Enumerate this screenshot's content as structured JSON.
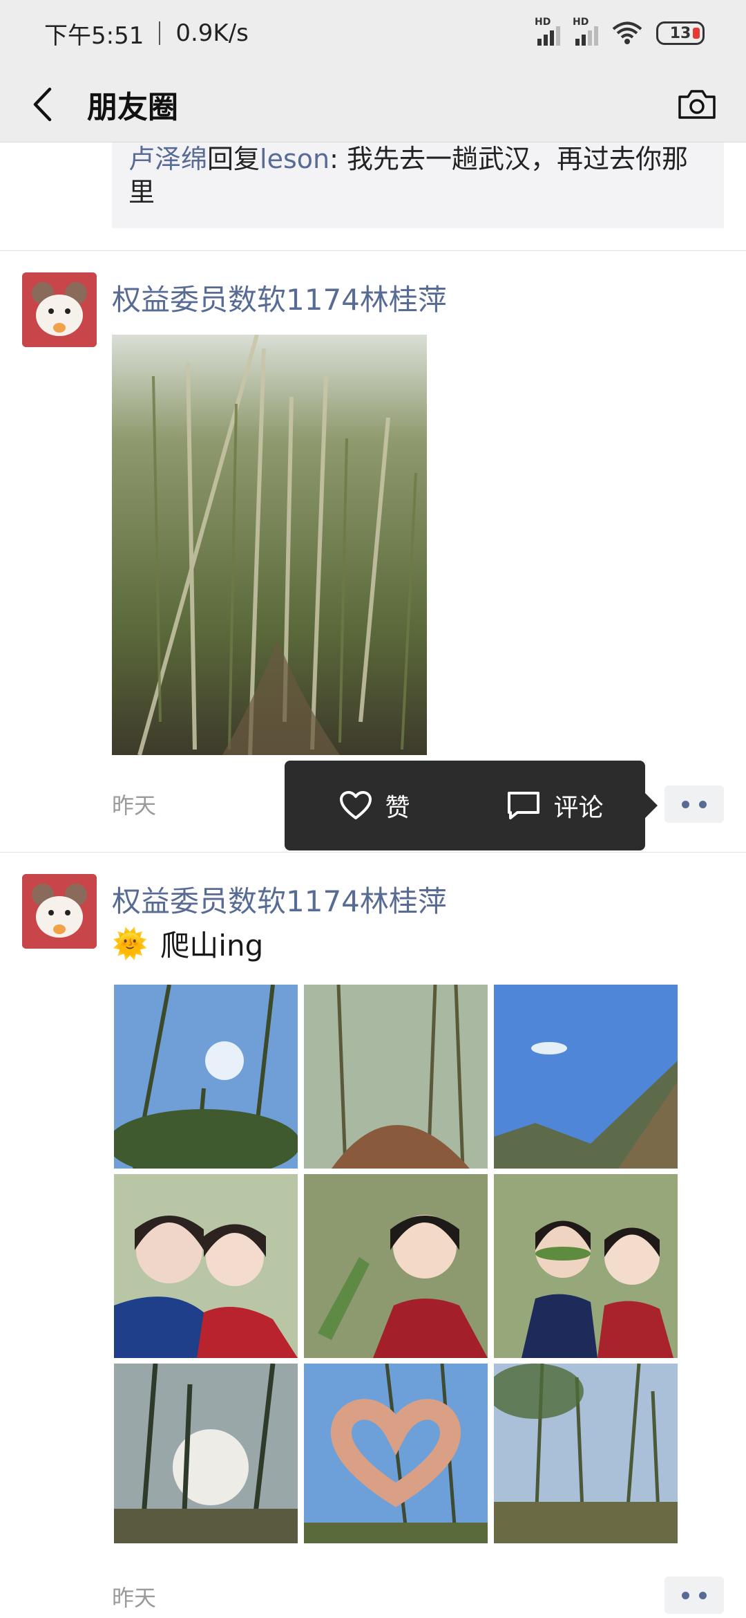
{
  "status_bar": {
    "time": "下午5:51",
    "speed": "0.9K/s",
    "signal1_label": "HD",
    "signal2_label": "HD",
    "battery": "13"
  },
  "nav": {
    "title": "朋友圈",
    "back_icon": "chevron-left-icon",
    "camera_icon": "camera-icon"
  },
  "previous_comment": {
    "commenter": "卢泽绵",
    "reply_word": "回复",
    "reply_to": "leson",
    "text": ": 我先去一趟武汉，再过去你那里"
  },
  "posts": [
    {
      "username": "权益委员数软1174林桂萍",
      "time": "昨天",
      "images": [
        "bamboo-forest-path"
      ]
    },
    {
      "username": "权益委员数软1174林桂萍",
      "emoji": "🌞",
      "text": "爬山ing",
      "time": "昨天",
      "images": [
        "tall-trees-sky",
        "forest-trail",
        "blue-sky-hill",
        "selfie-friends",
        "selfie-leaf",
        "friends-leaf",
        "sun-through-trees",
        "heart-hands-sky",
        "bamboo-canopy"
      ]
    }
  ],
  "action_popup": {
    "like_label": "赞",
    "comment_label": "评论"
  },
  "colors": {
    "link": "#576b95",
    "bar_bg": "#ededed",
    "popup_bg": "#2c2c2c"
  }
}
